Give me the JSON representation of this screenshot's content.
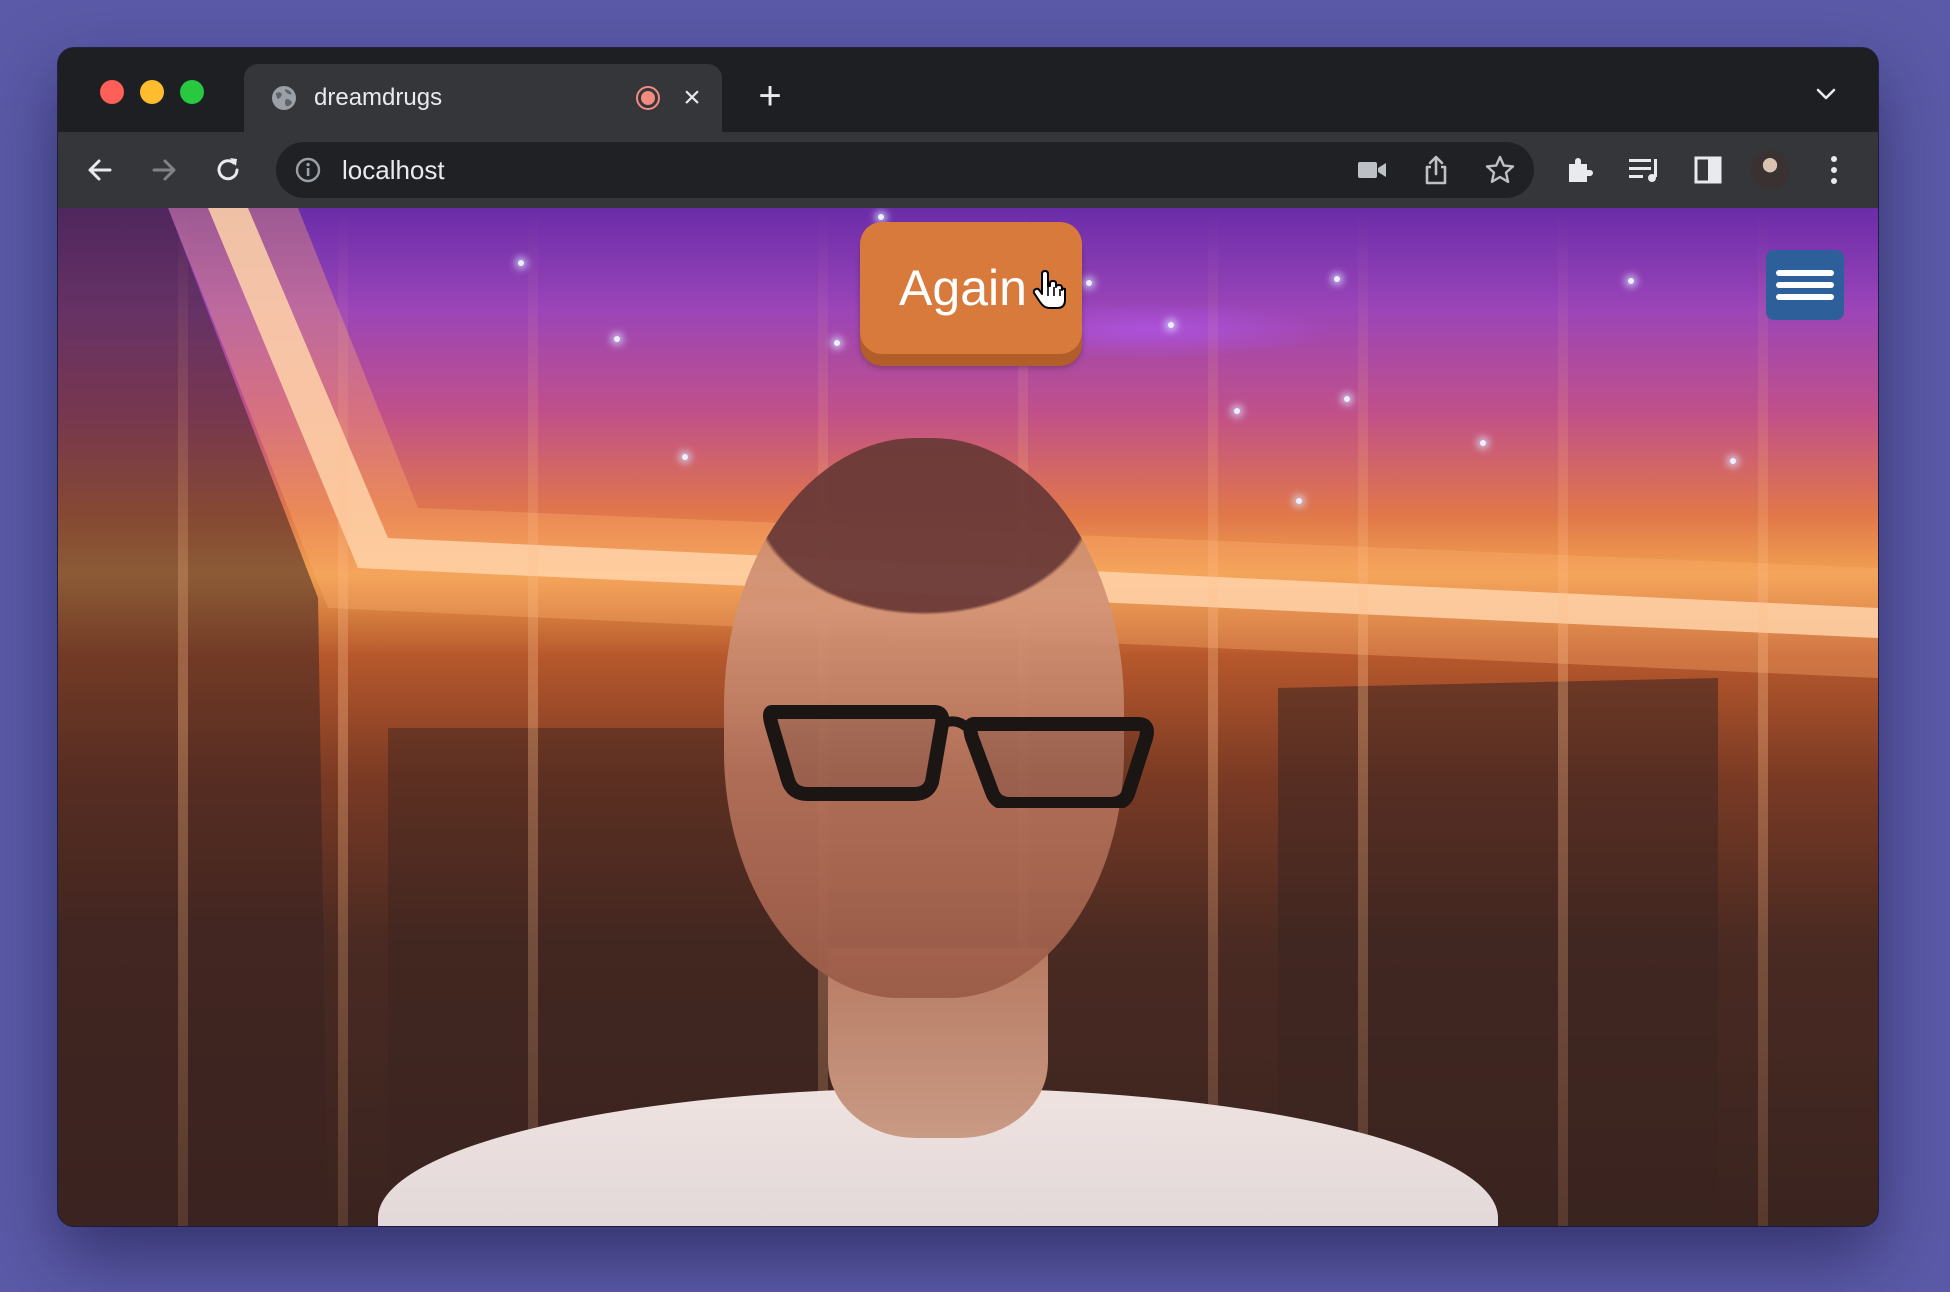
{
  "browser": {
    "tab": {
      "title": "dreamdrugs",
      "favicon": "globe-icon",
      "recording_indicator": "recording-icon",
      "close_label": "×"
    },
    "new_tab_label": "+",
    "address_bar": {
      "url": "localhost",
      "site_info_icon": "info-icon"
    },
    "toolbar_icons": [
      "back-arrow-icon",
      "forward-arrow-icon",
      "reload-icon",
      "camera-icon",
      "share-icon",
      "bookmark-star-icon",
      "extensions-puzzle-icon",
      "media-queue-icon",
      "side-panel-icon",
      "profile-avatar",
      "more-menu-icon"
    ]
  },
  "page": {
    "again_button": "Again",
    "menu_button_icon": "hamburger-icon"
  },
  "colors": {
    "desktop": "#5b5aa8",
    "again_button": "#d77a3c",
    "menu_button": "#2d5f9a",
    "titlebar": "#1e1f22",
    "toolbar": "#35363a"
  }
}
